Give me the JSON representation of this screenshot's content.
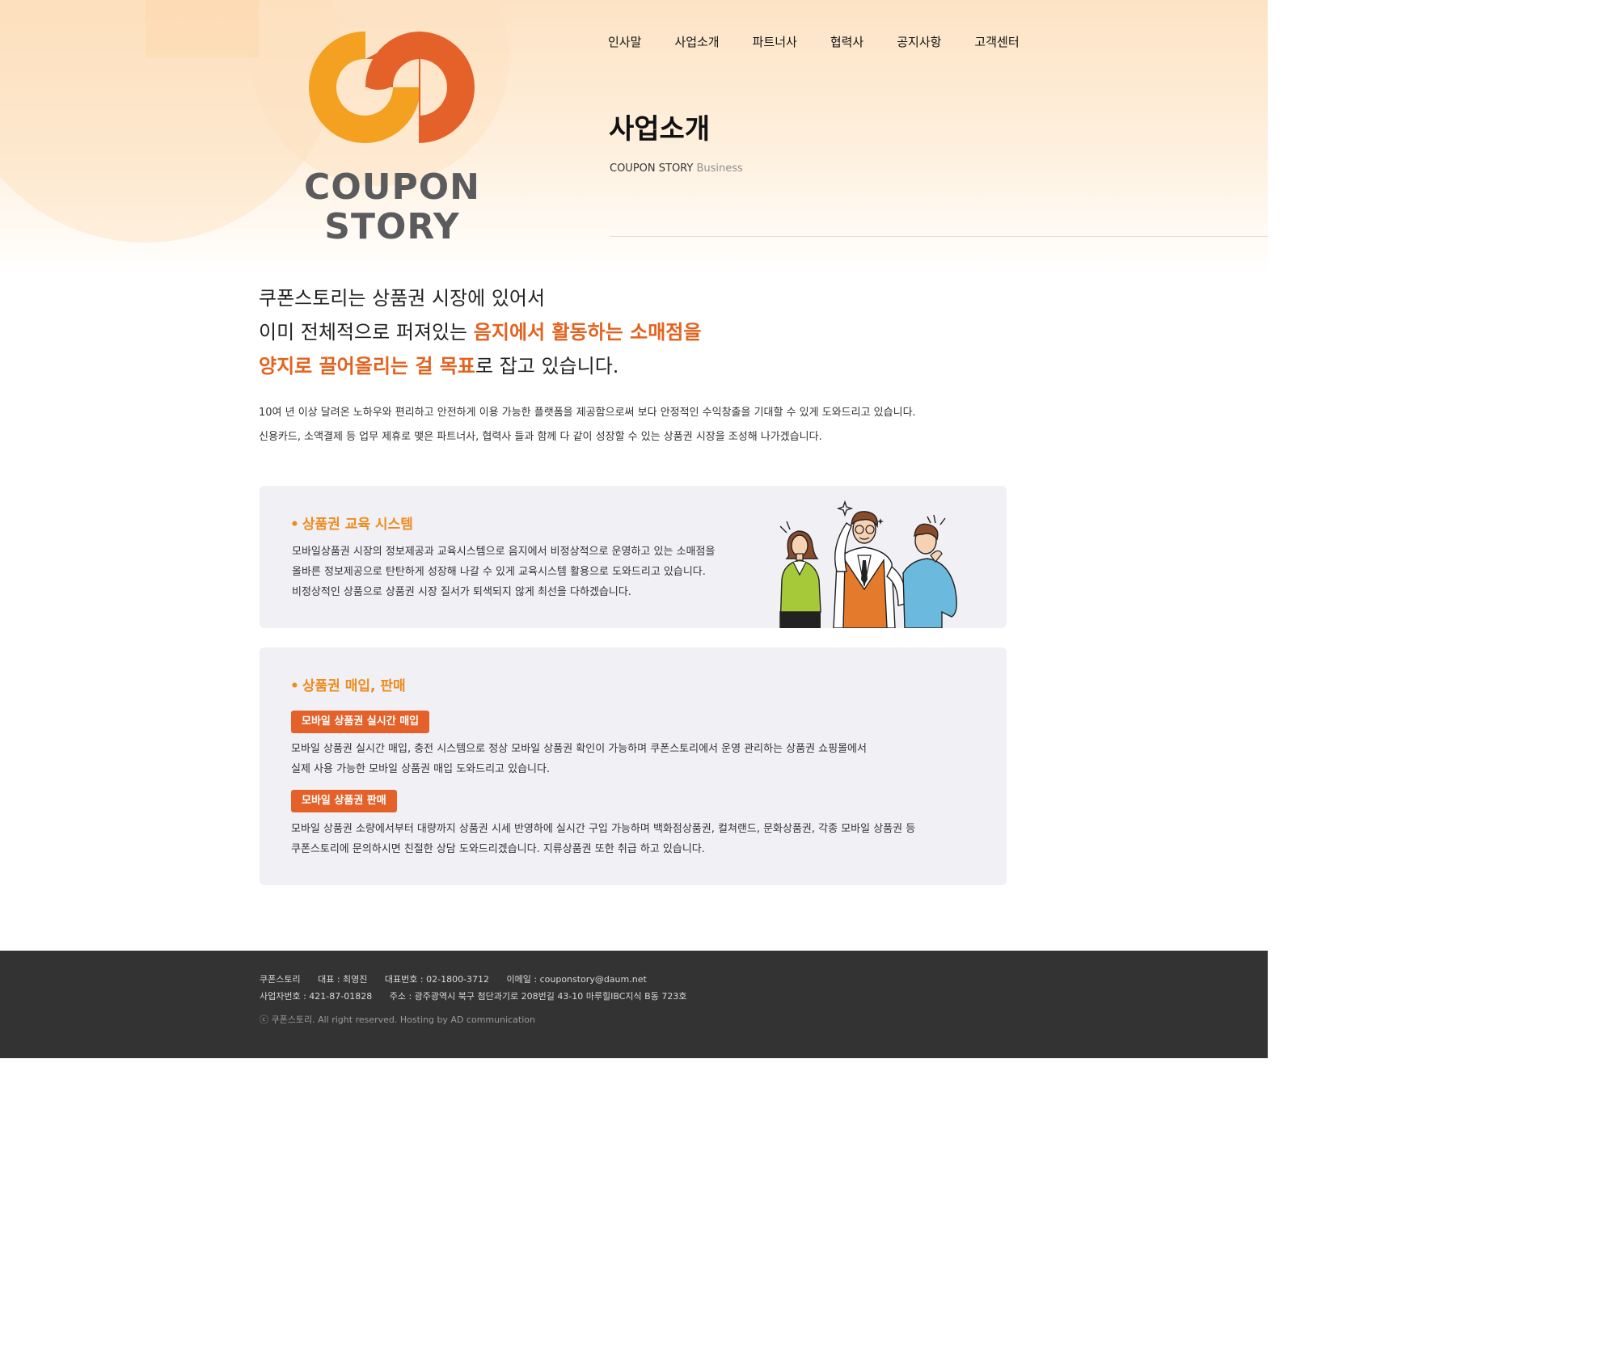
{
  "brand": {
    "logo_line1": "COUPON",
    "logo_line2": "STORY",
    "orange_light": "#f4a020",
    "orange_dark": "#e4622a",
    "text_gray": "#5b5b5d"
  },
  "nav": {
    "items": [
      "인사말",
      "사업소개",
      "파트너사",
      "협력사",
      "공지사항",
      "고객센터"
    ]
  },
  "header": {
    "title": "사업소개",
    "sub_main": "COUPON STORY",
    "sub_accent": "Business"
  },
  "intro": {
    "line1": "쿠폰스토리는 상품권 시장에 있어서",
    "line2_a": "이미 전체적으로 퍼져있는 ",
    "line2_b": "음지에서 활동하는 소매점을",
    "line3_a": "양지로 끌어올리는 걸 목표",
    "line3_b": "로 잡고 있습니다.",
    "desc1": "10여 년 이상 달려온 노하우와 편리하고 안전하게 이용 가능한 플랫폼을 제공함으로써 보다 안정적인 수익창출을 기대할 수 있게 도와드리고 있습니다.",
    "desc2": "신용카드, 소액결제 등 업무 제휴로 맺은 파트너사, 협력사 들과 함께 다 같이 성장할 수 있는 상품권 시장을 조성해 나가겠습니다."
  },
  "card1": {
    "bullet": "•",
    "title": "상품권 교육 시스템",
    "lines": [
      "모바일상품권 시장의 정보제공과 교육시스템으로 음지에서 비정상적으로 운영하고 있는 소매점을",
      "올바른 정보제공으로 탄탄하게 성장해 나갈 수 있게 교육시스템 활용으로 도와드리고 있습니다.",
      "비정상적인 상품으로 상품권 시장 질서가 퇴색되지 않게 최선을 다하겠습니다."
    ]
  },
  "card2": {
    "bullet": "•",
    "title": "상품권 매입, 판매",
    "tag1": "모바일 상품권 실시간 매입",
    "tag1_lines": [
      " 모바일 상품권 실시간 매입, 충전 시스템으로 정상 모바일 상품권 확인이 가능하며 쿠폰스토리에서 운영 관리하는 상품권 쇼핑몰에서",
      "실제 사용 가능한 모바일 상품권 매입 도와드리고 있습니다."
    ],
    "tag2": "모바일 상품권 판매",
    "tag2_lines": [
      "모바일 상품권 소량에서부터 대량까지 상품권 시세 반영하에 실시간 구입 가능하며 백화점상품권, 컬쳐랜드, 문화상품권, 각종 모바일 상품권 등",
      "쿠폰스토리에 문의하시면 친절한 상담 도와드리겠습니다. 지류상품권 또한 취급 하고 있습니다."
    ]
  },
  "footer": {
    "company": "쿠폰스토리",
    "ceo": "대표 : 최영진",
    "phone": "대표번호 : 02-1800-3712",
    "email": "이메일 : couponstory@daum.net",
    "biz_no": "사업자번호 : 421-87-01828",
    "address": "주소 : 광주광역시 북구 첨단과기로 208번길 43-10 마루힐IBC지식 B동 723호",
    "copyright": "ⓒ 쿠폰스토리. All right reserved. Hosting by AD communication"
  }
}
